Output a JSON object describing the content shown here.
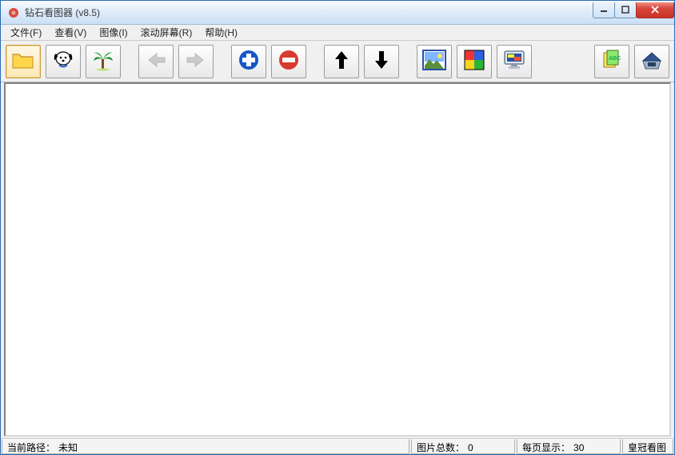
{
  "window": {
    "title": "钻石看图器 (v8.5)"
  },
  "menus": {
    "file": "文件(F)",
    "view": "查看(V)",
    "image": "图像(I)",
    "scroll": "滚动屏幕(R)",
    "help": "帮助(H)"
  },
  "toolbar": {
    "open_folder": "folder-icon",
    "dog": "dog-icon",
    "palm": "palm-tree-icon",
    "prev": "arrow-left-icon",
    "next": "arrow-right-icon",
    "zoom_in": "plus-icon",
    "zoom_out": "minus-icon",
    "move_up": "arrow-up-icon",
    "move_down": "arrow-down-icon",
    "thumbnail": "picture-icon",
    "colors": "color-grid-icon",
    "monitor": "monitor-icon",
    "tags": "tags-icon",
    "disk": "scanner-icon"
  },
  "status": {
    "path_label": "当前路径：",
    "path_value": "未知",
    "total_label": "图片总数：",
    "total_value": "0",
    "perpage_label": "每页显示：",
    "perpage_value": "30",
    "brand": "皇冠看图"
  }
}
